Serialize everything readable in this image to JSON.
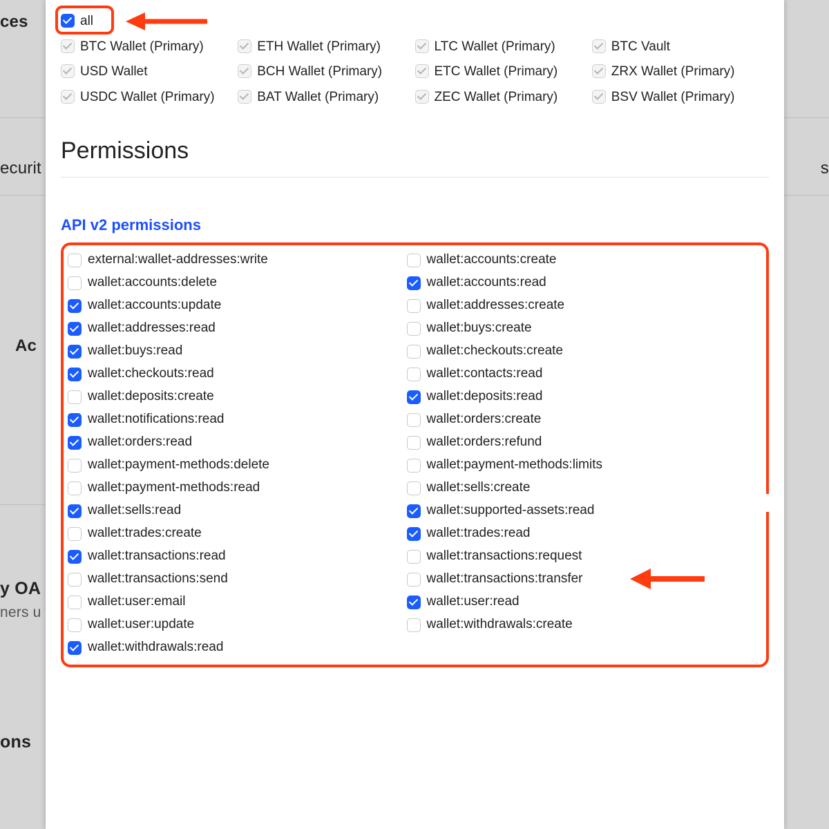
{
  "background": {
    "left1": "ces",
    "left2": "ecurit",
    "left3": "Ac",
    "left4": "y OA",
    "left5": "ners u",
    "left6": "ons",
    "right1": "s"
  },
  "accounts": {
    "all_label": "all",
    "items": [
      "BTC Wallet (Primary)",
      "ETH Wallet (Primary)",
      "LTC Wallet (Primary)",
      "BTC Vault",
      "USD Wallet",
      "BCH Wallet (Primary)",
      "ETC Wallet (Primary)",
      "ZRX Wallet (Primary)",
      "USDC Wallet (Primary)",
      "BAT Wallet (Primary)",
      "ZEC Wallet (Primary)",
      "BSV Wallet (Primary)"
    ]
  },
  "sections": {
    "permissions_heading": "Permissions",
    "api_heading": "API v2 permissions"
  },
  "permissions": [
    {
      "label": "external:wallet-addresses:write",
      "checked": false
    },
    {
      "label": "wallet:accounts:create",
      "checked": false
    },
    {
      "label": "wallet:accounts:delete",
      "checked": false
    },
    {
      "label": "wallet:accounts:read",
      "checked": true
    },
    {
      "label": "wallet:accounts:update",
      "checked": true
    },
    {
      "label": "wallet:addresses:create",
      "checked": false
    },
    {
      "label": "wallet:addresses:read",
      "checked": true
    },
    {
      "label": "wallet:buys:create",
      "checked": false
    },
    {
      "label": "wallet:buys:read",
      "checked": true
    },
    {
      "label": "wallet:checkouts:create",
      "checked": false
    },
    {
      "label": "wallet:checkouts:read",
      "checked": true
    },
    {
      "label": "wallet:contacts:read",
      "checked": false
    },
    {
      "label": "wallet:deposits:create",
      "checked": false
    },
    {
      "label": "wallet:deposits:read",
      "checked": true
    },
    {
      "label": "wallet:notifications:read",
      "checked": true
    },
    {
      "label": "wallet:orders:create",
      "checked": false
    },
    {
      "label": "wallet:orders:read",
      "checked": true
    },
    {
      "label": "wallet:orders:refund",
      "checked": false
    },
    {
      "label": "wallet:payment-methods:delete",
      "checked": false
    },
    {
      "label": "wallet:payment-methods:limits",
      "checked": false
    },
    {
      "label": "wallet:payment-methods:read",
      "checked": false
    },
    {
      "label": "wallet:sells:create",
      "checked": false
    },
    {
      "label": "wallet:sells:read",
      "checked": true
    },
    {
      "label": "wallet:supported-assets:read",
      "checked": true
    },
    {
      "label": "wallet:trades:create",
      "checked": false
    },
    {
      "label": "wallet:trades:read",
      "checked": true
    },
    {
      "label": "wallet:transactions:read",
      "checked": true
    },
    {
      "label": "wallet:transactions:request",
      "checked": false
    },
    {
      "label": "wallet:transactions:send",
      "checked": false
    },
    {
      "label": "wallet:transactions:transfer",
      "checked": false
    },
    {
      "label": "wallet:user:email",
      "checked": false
    },
    {
      "label": "wallet:user:read",
      "checked": true
    },
    {
      "label": "wallet:user:update",
      "checked": false
    },
    {
      "label": "wallet:withdrawals:create",
      "checked": false
    },
    {
      "label": "wallet:withdrawals:read",
      "checked": true
    }
  ]
}
